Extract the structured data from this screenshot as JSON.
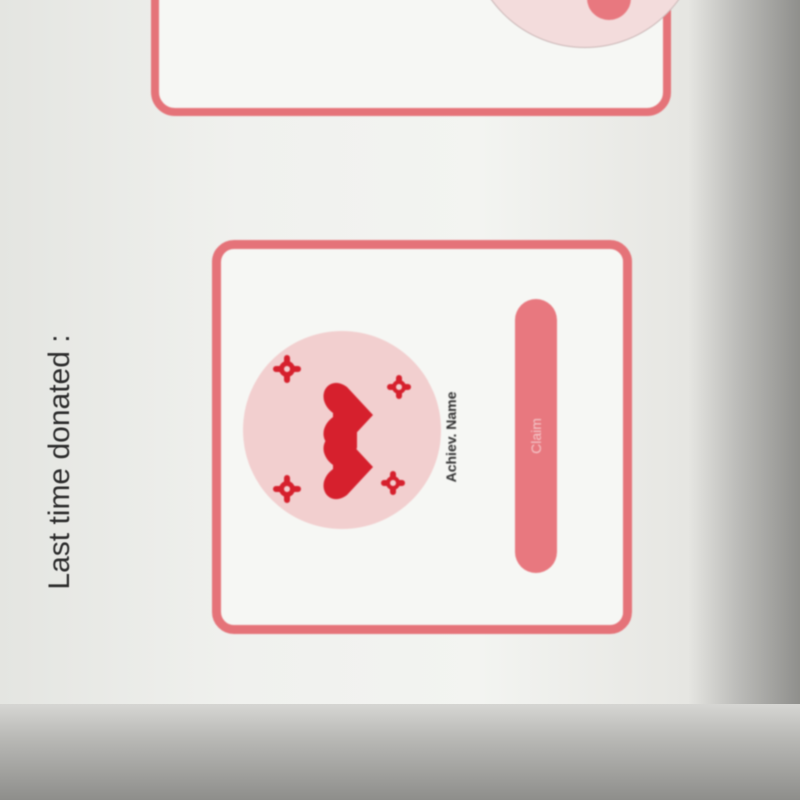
{
  "heading": "Last time donated :",
  "cards": [
    {
      "title": "Achiev. Name",
      "description": "",
      "claim_label": "Claim",
      "icon": "joined-hearts-icon"
    },
    {
      "description": "",
      "icon": "donation-illustration-icon"
    }
  ],
  "colors": {
    "accent": "#e57379",
    "button": "#e8787f",
    "illustration_bg": "#f2cfcf",
    "heart": "#d6202d"
  }
}
